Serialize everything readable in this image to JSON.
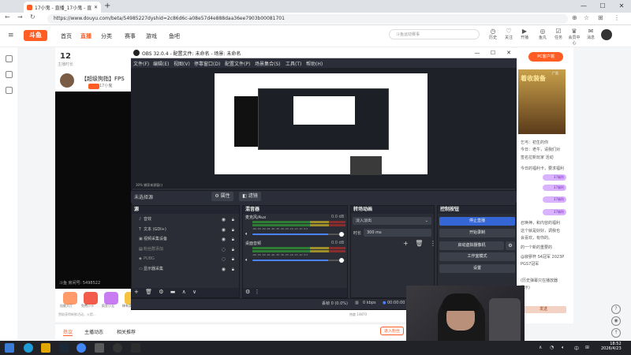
{
  "browser": {
    "tab_title": "17小鬼 - 直播_17小鬼 - 直播_17小",
    "new_tab": "+",
    "url": "https://www.douyu.com/beta/54985227dyshid=2c86d6c-a08e57d4e888daa36ee7903b00081701",
    "win_minimize": "—",
    "win_maximize": "☐",
    "win_close": "✕"
  },
  "douyu": {
    "logo": "斗鱼",
    "nav": [
      "首页",
      "直播",
      "分类",
      "赛事",
      "游戏",
      "鱼吧"
    ],
    "search_placeholder": "斗鱼运动赛事",
    "header_icons": [
      {
        "icon": "history-icon",
        "label": "历史"
      },
      {
        "icon": "follow-icon",
        "label": "关注"
      },
      {
        "icon": "live-icon",
        "label": "开播"
      },
      {
        "icon": "level-icon",
        "label": "鱼丸"
      },
      {
        "icon": "task-icon",
        "label": "任务"
      },
      {
        "icon": "vip-icon",
        "label": "会员中心"
      },
      {
        "icon": "message-icon",
        "label": "消息"
      }
    ],
    "viewers": "12",
    "viewers_label": "主播时长",
    "room_title": "【超级狗指】FPS",
    "badge_text": "17小鬼",
    "video_caption": "斗鱼 房间号: 5498522",
    "gifts": [
      "佳能大厅",
      "免费小卡",
      "疯狂小丑",
      "稀有奖杯"
    ],
    "gift_note": "赞助获得新鲜活动，火箭...",
    "room_stats": "热度 14870",
    "bottom_tabs": [
      "热议",
      "主播动态",
      "相关推荐"
    ],
    "enter_fans": "进入粉丝",
    "right": {
      "pc_button": "PC客户端",
      "ad_title": "着收装备",
      "ad_tag": "广告",
      "lines": [
        "乞丐：初生的你",
        "今日：老牛，请我们对",
        "签名拉新玩家 活动",
        "今日的福利卡，要求福利",
        "37福利",
        "37福利",
        "37福利",
        "37福利",
        "召唤神，和内容的福利",
        "这个就是好好，调我也",
        "会喜欢，有你的。",
        "的一个新的重要的",
        "@寂寥杯 S4冠军 2023P",
        "PGS7冠军",
        "(历史弹幕只在播放器",
        "展示)"
      ],
      "bottom_btn": "发送"
    }
  },
  "obs": {
    "title": "OBS 32.0.4 - 配置文件: 未命名 - 场景: 未命名",
    "menus": [
      "文件(F)",
      "编辑(E)",
      "视图(V)",
      "停靠窗口(D)",
      "配置文件(P)",
      "场景集合(S)",
      "工具(T)",
      "帮助(H)"
    ],
    "zoom": "30%",
    "zoom_note": "捕获来源窗口",
    "no_scene": "未选择源",
    "btn_properties": "属性",
    "btn_filters": "滤镜",
    "docks": {
      "sources": "源",
      "mixer": "混音器",
      "transitions": "转场动画",
      "controls": "控制按钮"
    },
    "sources": [
      {
        "icon": "audio-icon",
        "name": "音效",
        "dim": false
      },
      {
        "icon": "text-icon",
        "name": "文本 (GDI+)",
        "dim": false
      },
      {
        "icon": "camera-icon",
        "name": "视频采集设备",
        "dim": false
      },
      {
        "icon": "image-icon",
        "name": "粉丝群添加",
        "dim": true
      },
      {
        "icon": "game-icon",
        "name": "PUBG",
        "dim": true
      },
      {
        "icon": "monitor-icon",
        "name": "显示器采集",
        "dim": false
      }
    ],
    "mixer": [
      {
        "name": "麦克风/Aux",
        "db": "0.0 dB",
        "level": 0.82
      },
      {
        "name": "桌面音频",
        "db": "0.0 dB",
        "level": 0.82
      }
    ],
    "meter_scale": "-60 -55 -50 -45 -40 -35 -30 -25 -20 -15 -10 -5 0",
    "transition": "淡入淡出",
    "duration_label": "时长",
    "duration_value": "300 ms",
    "controls": [
      "停止直播",
      "开始录制",
      "启动虚拟摄像机",
      "工作室模式",
      "设置"
    ],
    "status": {
      "dropped": "丢帧 0 (0.0%)",
      "kbps": "0 kbps",
      "time": "00:00:00"
    }
  },
  "taskbar": {
    "time": "18:52",
    "date": "2026/4/23",
    "tray_lang": "中"
  }
}
